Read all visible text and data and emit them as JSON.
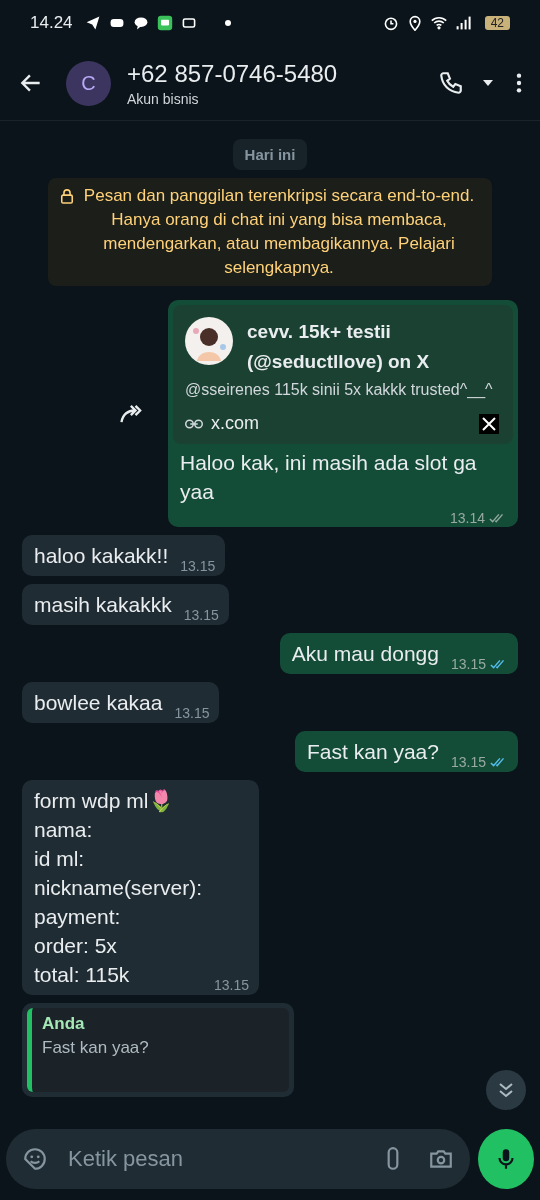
{
  "status_bar": {
    "time": "14.24",
    "battery": "42"
  },
  "header": {
    "avatar_letter": "C",
    "title": "+62 857-0746-5480",
    "subtitle": "Akun bisnis"
  },
  "date_chip": "Hari ini",
  "encryption_notice": "Pesan dan panggilan terenkripsi secara end-to-end. Hanya orang di chat ini yang bisa membaca, mendengarkan, atau membagikannya. Pelajari selengkapnya.",
  "messages": [
    {
      "kind": "link",
      "outgoing": true,
      "read": false,
      "preview": {
        "title": "cevv. 15k+ testii (@seductllove) on X",
        "description": "@sseirenes 115k sinii 5x kakkk trusted^__^",
        "domain": "x.com"
      },
      "text": "Haloo kak, ini masih ada slot ga yaa",
      "time": "13.14"
    },
    {
      "kind": "text",
      "outgoing": false,
      "text": "haloo kakakk!!",
      "time": "13.15"
    },
    {
      "kind": "text",
      "outgoing": false,
      "text": "masih kakakkk",
      "time": "13.15"
    },
    {
      "kind": "text",
      "outgoing": true,
      "read": true,
      "text": "Aku mau dongg",
      "time": "13.15"
    },
    {
      "kind": "text",
      "outgoing": false,
      "text": "bowlee kakaa",
      "time": "13.15"
    },
    {
      "kind": "text",
      "outgoing": true,
      "read": true,
      "text": "Fast kan yaa?",
      "time": "13.15"
    },
    {
      "kind": "text",
      "outgoing": false,
      "text": "form wdp ml🌷\nnama:\nid ml:\nnickname(server):\npayment:\norder: 5x\ntotal: 115k",
      "time": "13.15"
    },
    {
      "kind": "reply",
      "outgoing": false,
      "quote": {
        "author": "Anda",
        "text": "Fast kan yaa?"
      }
    }
  ],
  "composer": {
    "placeholder": "Ketik pesan"
  }
}
